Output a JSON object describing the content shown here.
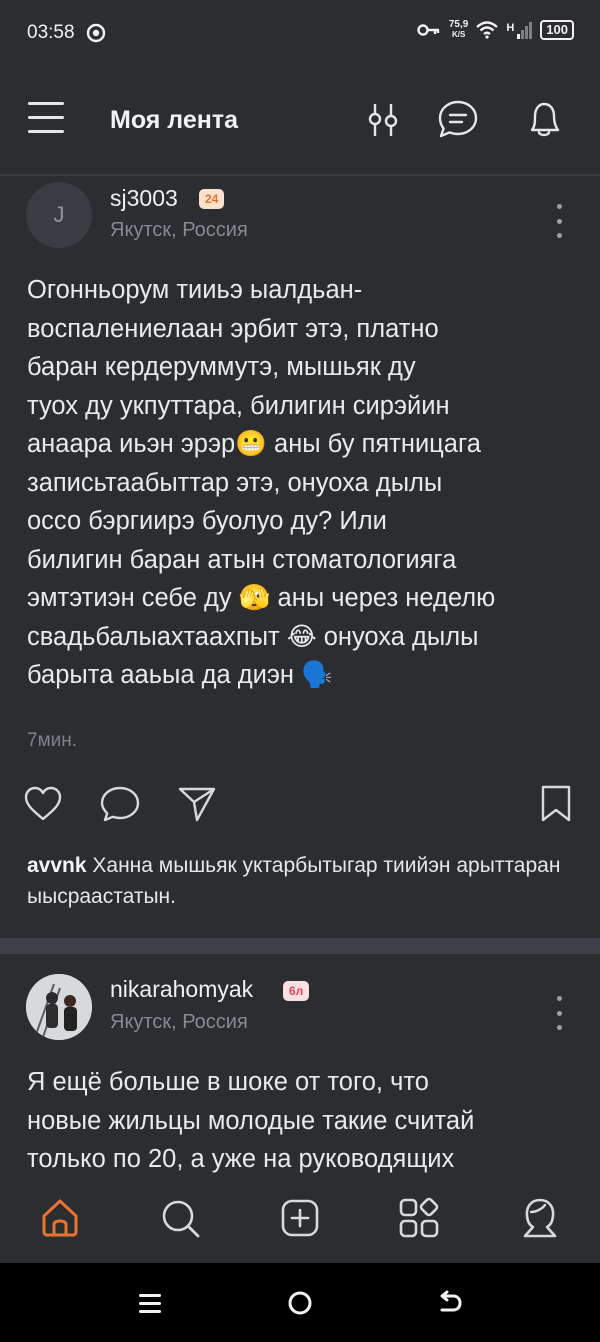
{
  "status_bar": {
    "time": "03:58",
    "net_speed_value": "75,9",
    "net_speed_unit": "K/S",
    "network_type": "H",
    "battery": "100",
    "icons": [
      "notification-icon",
      "key-icon",
      "wifi-icon",
      "signal-icon",
      "battery-icon"
    ]
  },
  "header": {
    "title": "Моя лента",
    "icons": [
      "menu-icon",
      "filter-icon",
      "messages-icon",
      "notifications-icon"
    ]
  },
  "posts": [
    {
      "author": "sj3003",
      "avatar_letter": "J",
      "badge": "24",
      "location": "Якутск, Россия",
      "text": "Огонньорум тииьэ ыалдьан-\nвоспалениелаан эрбит этэ, платно\nбаран кердеруммутэ, мышьяк ду\nтуох ду укпуттара, билигин сирэйин\nанаара иьэн эрэр😬 аны бу пятницага\nзаписьтаабыттар этэ, онуоха дылы\nоссо бэргиирэ буолуо ду? Или\nбилигин баран атын стоматологияга\nэмтэтиэн себе ду 🫣 аны через неделю\nсвадьбалыахтаахпыт 😂 онуоха дылы\nбарыта ааьыа да диэн 🗣️",
      "time": "7мин.",
      "comment": {
        "author": "avvnk",
        "text": "Ханна мышьяк уктарбытыгар тиийэн арыттаран ыысраастатын."
      }
    },
    {
      "author": "nikarahomyak",
      "badge": "6л",
      "location": "Якутск, Россия",
      "text": "Я ещё больше в шоке от того, что\nновые жильцы молодые такие считай\nтолько по 20, а уже на руководящих"
    }
  ],
  "tab_bar": {
    "tabs": [
      "home-icon",
      "search-icon",
      "create-post-icon",
      "services-icon",
      "profile-icon"
    ],
    "active_color": "#e8742f"
  },
  "system_nav": [
    "menu-icon",
    "home-icon",
    "back-icon"
  ]
}
